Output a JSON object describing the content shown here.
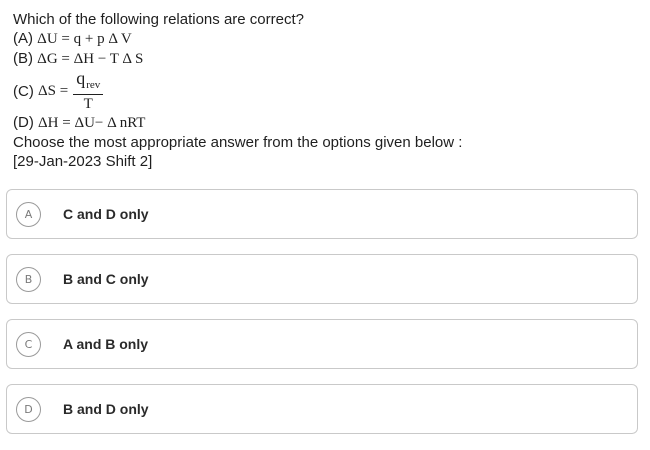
{
  "question": {
    "prompt": "Which of the following relations are correct?",
    "a": {
      "prefix": "(A) ",
      "expr": "ΔU = q + p Δ V"
    },
    "b": {
      "prefix": "(B) ",
      "expr": "ΔG = ΔH − T Δ S"
    },
    "c": {
      "prefix": "(C) ",
      "lhs": "ΔS =",
      "num_q": "q",
      "num_sub": "rev",
      "den": "T"
    },
    "d": {
      "prefix": "(D) ",
      "expr": "ΔH = ΔU− Δ nRT"
    },
    "instruction": "Choose the most appropriate answer from the options given below :",
    "source": "[29-Jan-2023 Shift 2]"
  },
  "options": [
    {
      "badge": "A",
      "text": "C and D only"
    },
    {
      "badge": "B",
      "text": "B and C only"
    },
    {
      "badge": "C",
      "text": "A and B only"
    },
    {
      "badge": "D",
      "text": "B and D only"
    }
  ]
}
